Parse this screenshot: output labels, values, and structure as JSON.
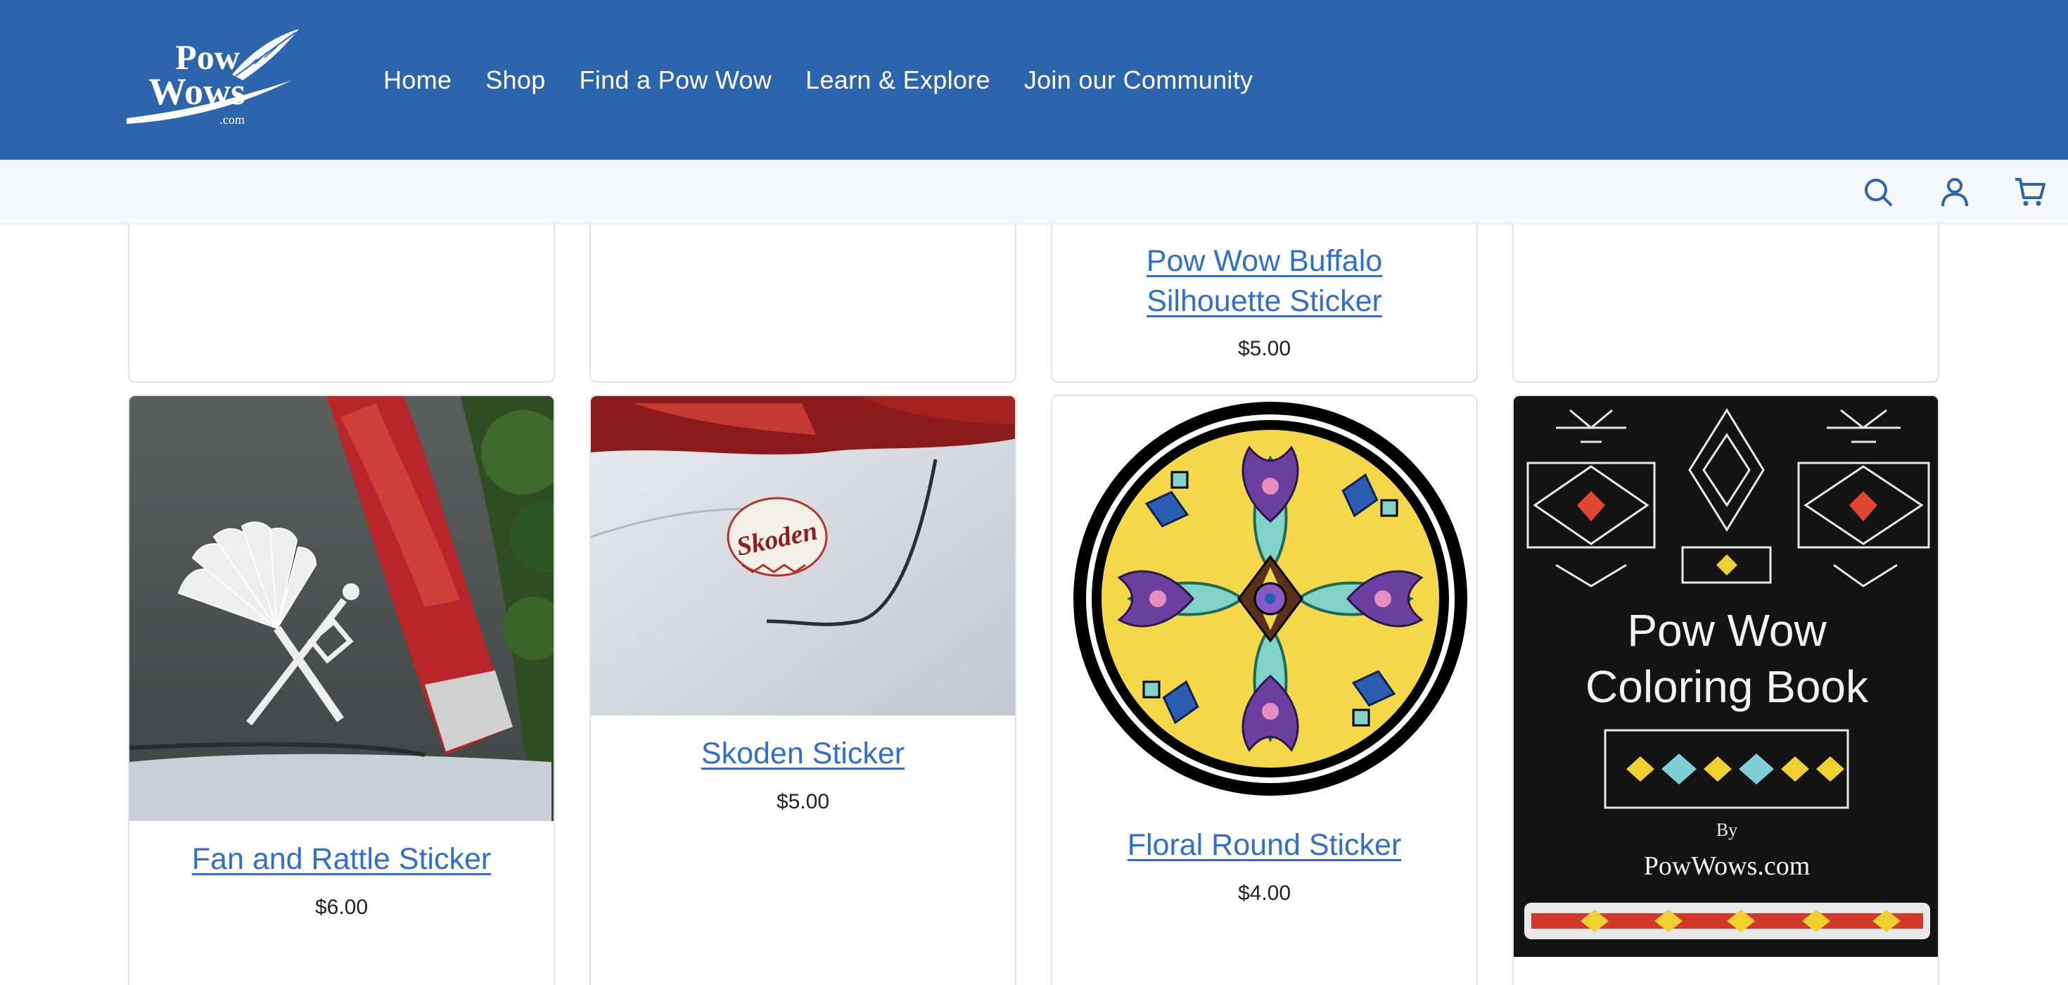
{
  "header": {
    "logo_text": "PowWows.com",
    "nav": [
      {
        "label": "Home"
      },
      {
        "label": "Shop"
      },
      {
        "label": "Find a Pow Wow"
      },
      {
        "label": "Learn & Explore"
      },
      {
        "label": "Join our Community"
      }
    ],
    "brand_color": "#2c64ae"
  },
  "toolbar": {
    "icons": [
      "search-icon",
      "account-icon",
      "cart-icon"
    ]
  },
  "products_top": [
    {
      "title": "",
      "price": ""
    },
    {
      "title": "",
      "price": ""
    },
    {
      "title": "Pow Wow Buffalo Silhouette Sticker",
      "title_line1": "Pow Wow Buffalo",
      "title_line2": "Silhouette Sticker",
      "price": "$5.00"
    },
    {
      "title": "",
      "price": ""
    }
  ],
  "products": [
    {
      "title": "Fan and Rattle Sticker",
      "price": "$6.00",
      "image": "fan-rattle-car-decal"
    },
    {
      "title": "Skoden Sticker",
      "price": "$5.00",
      "image": "skoden-car-decal"
    },
    {
      "title": "Floral Round Sticker",
      "price": "$4.00",
      "image": "floral-round-sticker"
    },
    {
      "title": "",
      "price": "",
      "image": "coloring-book-cover",
      "cover_title_line1": "Pow Wow",
      "cover_title_line2": "Coloring Book",
      "cover_by": "By",
      "cover_author": "PowWows.com"
    }
  ],
  "colors": {
    "link": "#2f6fd3",
    "icon": "#2c64ae"
  }
}
